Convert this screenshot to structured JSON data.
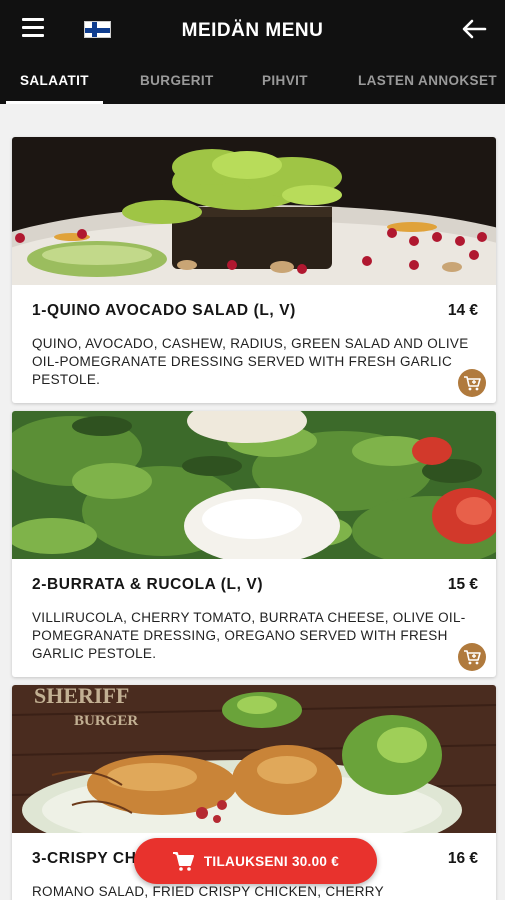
{
  "header": {
    "title": "MEIDÄN MENU",
    "menu_icon": "hamburger-menu-icon",
    "flag_icon": "finland-flag-icon",
    "back_icon": "arrow-left-icon"
  },
  "tabs": [
    {
      "label": "SALAATIT",
      "active": true
    },
    {
      "label": "BURGERIT",
      "active": false
    },
    {
      "label": "PIHVIT",
      "active": false
    },
    {
      "label": "LASTEN ANNOKSET",
      "active": false
    }
  ],
  "items": [
    {
      "name": "1-QUINO AVOCADO SALAD (L, V)",
      "price": "14 €",
      "description": "QUINO, AVOCADO, CASHEW, RADIUS, GREEN SALAD AND OLIVE OIL-POMEGRANATE DRESSING SERVED WITH FRESH GARLIC PESTOLE."
    },
    {
      "name": "2-BURRATA & RUCOLA (L, V)",
      "price": "15 €",
      "description": "VILLIRUCOLA, CHERRY TOMATO, BURRATA CHEESE, OLIVE OIL-POMEGRANATE DRESSING, OREGANO SERVED WITH FRESH GARLIC PESTOLE."
    },
    {
      "name": "3-CRISPY CHICKEN SALAD (L)",
      "price": "16 €",
      "description": "ROMANO SALAD, FRIED CRISPY CHICKEN, CHERRY",
      "photo_text": {
        "line1": "SHERIFF",
        "line2": "BURGER"
      }
    }
  ],
  "order_button": {
    "label": "TILAUKSENI 30.00 €",
    "icon": "shopping-cart-icon"
  },
  "colors": {
    "header_bg": "#111111",
    "accent_brown": "#b07a3d",
    "order_red": "#e8322d"
  }
}
